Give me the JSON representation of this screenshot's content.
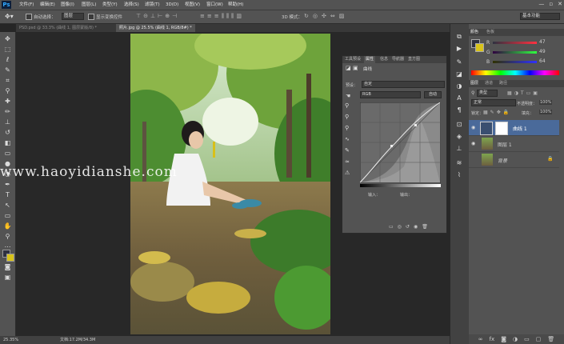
{
  "app": {
    "logo": "Ps"
  },
  "menubar": {
    "items": [
      "文件(F)",
      "编辑(E)",
      "图像(I)",
      "图层(L)",
      "类型(Y)",
      "选择(S)",
      "滤镜(T)",
      "3D(D)",
      "视图(V)",
      "窗口(W)",
      "帮助(H)"
    ],
    "window_controls": [
      "—",
      "▫",
      "✕"
    ]
  },
  "options": {
    "auto_select_label": "自动选择：",
    "auto_select_value": "图层",
    "show_transform_label": "显示变换控件",
    "mode_3d_label": "3D 模式：",
    "workspace": "基本功能"
  },
  "tabs": [
    {
      "label": "PSD.psd @ 33.3% (曲线 1, 图层蒙版/8) *",
      "active": false
    },
    {
      "label": "照片.jpg @ 25.5% (曲线 1, RGB/8#) *",
      "active": true
    }
  ],
  "status": {
    "zoom": "25.35%",
    "doc": "文档:17.2M/34.3M"
  },
  "watermark": "www.haoyidianshe.com",
  "properties": {
    "tabs": [
      "工具预设",
      "属性",
      "信息",
      "导航器",
      "直方图"
    ],
    "title": "曲线",
    "preset_label": "预设：",
    "preset_value": "自定",
    "channel_value": "RGB",
    "auto_button": "自动",
    "input_label": "输入：",
    "output_label": "输出："
  },
  "color": {
    "tabs": [
      "颜色",
      "色板"
    ],
    "r_label": "R",
    "r_value": "47",
    "g_label": "G",
    "g_value": "49",
    "b_label": "B",
    "b_value": "64",
    "r_level": 0.18,
    "g_level": 0.19,
    "b_level": 0.25
  },
  "layers": {
    "tabs": [
      "图层",
      "通道",
      "路径"
    ],
    "filter_value": "类型",
    "blend_mode": "正常",
    "opacity_label": "不透明度：",
    "opacity_value": "100%",
    "lock_label": "锁定：",
    "fill_label": "填充：",
    "fill_value": "100%",
    "items": [
      {
        "name": "曲线 1",
        "selected": true
      },
      {
        "name": "图层 1",
        "selected": false
      },
      {
        "name": "背景",
        "selected": false
      }
    ]
  },
  "colors": {
    "ps_blue": "#31a8ff",
    "panel": "#535353",
    "selected": "#4a6a9a"
  }
}
